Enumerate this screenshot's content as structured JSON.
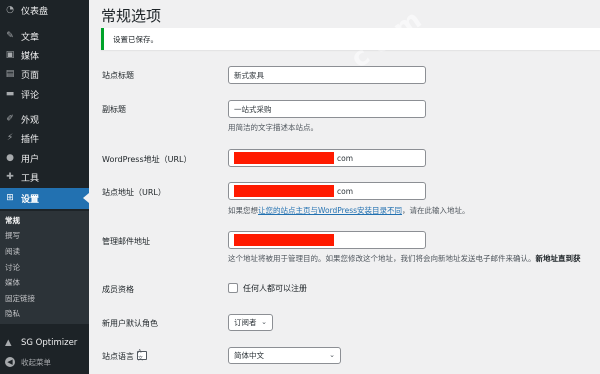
{
  "sidebar": {
    "items": [
      {
        "label": "仪表盘",
        "icon": "dashboard-icon",
        "glyph": "◔"
      },
      {
        "label": "文章",
        "icon": "pin-icon",
        "glyph": "✎"
      },
      {
        "label": "媒体",
        "icon": "media-icon",
        "glyph": "▣"
      },
      {
        "label": "页面",
        "icon": "page-icon",
        "glyph": "▤"
      },
      {
        "label": "评论",
        "icon": "comment-icon",
        "glyph": "▬"
      },
      {
        "label": "外观",
        "icon": "brush-icon",
        "glyph": "✐"
      },
      {
        "label": "插件",
        "icon": "plugin-icon",
        "glyph": "⚡"
      },
      {
        "label": "用户",
        "icon": "user-icon",
        "glyph": "●"
      },
      {
        "label": "工具",
        "icon": "tools-icon",
        "glyph": "✚"
      },
      {
        "label": "设置",
        "icon": "settings-icon",
        "glyph": "⊞"
      }
    ],
    "submenu": [
      "常规",
      "撰写",
      "阅读",
      "讨论",
      "媒体",
      "固定链接",
      "隐私"
    ],
    "sg_optimizer": "SG Optimizer",
    "collapse": "收起菜单"
  },
  "page": {
    "title": "常规选项",
    "notice": "设置已保存。"
  },
  "fields": {
    "site_title": {
      "label": "站点标题",
      "value": "新式家具"
    },
    "tagline": {
      "label": "副标题",
      "value": "一站式采购",
      "desc": "用简洁的文字描述本站点。"
    },
    "wp_url": {
      "label": "WordPress地址（URL）",
      "suffix": "com"
    },
    "site_url": {
      "label": "站点地址（URL）",
      "suffix": "com",
      "desc_pre": "如果您想",
      "desc_link": "让您的站点主页与WordPress安装目录不同",
      "desc_post": "，请在此输入地址。"
    },
    "admin_email": {
      "label": "管理邮件地址",
      "desc_pre": "这个地址将被用于管理目的。如果您修改这个地址，我们将会向新地址发送电子邮件来确认。",
      "desc_bold": "新地址直到获"
    },
    "membership": {
      "label": "成员资格",
      "checkbox_label": "任何人都可以注册"
    },
    "default_role": {
      "label": "新用户默认角色",
      "value": "订阅者"
    },
    "site_language": {
      "label": "站点语言",
      "value": "简体中文"
    }
  },
  "colors": {
    "sidebar_bg": "#1d2327",
    "accent": "#2271b1",
    "notice_border": "#00a32a",
    "redaction": "#ff1a00"
  }
}
